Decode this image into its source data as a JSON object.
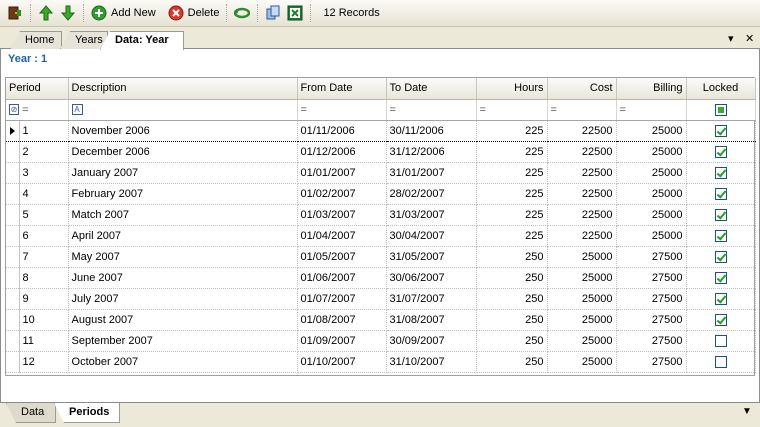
{
  "toolbar": {
    "add_new_label": "Add New",
    "delete_label": "Delete",
    "record_count": "12 Records"
  },
  "tabs": [
    {
      "label": "Home"
    },
    {
      "label": "Years"
    },
    {
      "label": "Data: Year"
    }
  ],
  "window_controls": {
    "menu": "▾",
    "close": "✕"
  },
  "caption": "Year : 1",
  "grid": {
    "columns": [
      "Period",
      "Description",
      "From Date",
      "To Date",
      "Hours",
      "Cost",
      "Billing",
      "Locked"
    ],
    "filter_op": "=",
    "rows": [
      {
        "period": "1",
        "description": "November 2006",
        "from": "01/11/2006",
        "to": "30/11/2006",
        "hours": "225",
        "cost": "22500",
        "billing": "25000",
        "locked": true
      },
      {
        "period": "2",
        "description": "December 2006",
        "from": "01/12/2006",
        "to": "31/12/2006",
        "hours": "225",
        "cost": "22500",
        "billing": "25000",
        "locked": true
      },
      {
        "period": "3",
        "description": "January 2007",
        "from": "01/01/2007",
        "to": "31/01/2007",
        "hours": "225",
        "cost": "22500",
        "billing": "25000",
        "locked": true
      },
      {
        "period": "4",
        "description": "February 2007",
        "from": "01/02/2007",
        "to": "28/02/2007",
        "hours": "225",
        "cost": "22500",
        "billing": "25000",
        "locked": true
      },
      {
        "period": "5",
        "description": "Match 2007",
        "from": "01/03/2007",
        "to": "31/03/2007",
        "hours": "225",
        "cost": "22500",
        "billing": "25000",
        "locked": true
      },
      {
        "period": "6",
        "description": "April 2007",
        "from": "01/04/2007",
        "to": "30/04/2007",
        "hours": "225",
        "cost": "22500",
        "billing": "25000",
        "locked": true
      },
      {
        "period": "7",
        "description": "May 2007",
        "from": "01/05/2007",
        "to": "31/05/2007",
        "hours": "250",
        "cost": "25000",
        "billing": "27500",
        "locked": true
      },
      {
        "period": "8",
        "description": "June 2007",
        "from": "01/06/2007",
        "to": "30/06/2007",
        "hours": "250",
        "cost": "25000",
        "billing": "27500",
        "locked": true
      },
      {
        "period": "9",
        "description": "July 2007",
        "from": "01/07/2007",
        "to": "31/07/2007",
        "hours": "250",
        "cost": "25000",
        "billing": "27500",
        "locked": true
      },
      {
        "period": "10",
        "description": "August 2007",
        "from": "01/08/2007",
        "to": "31/08/2007",
        "hours": "250",
        "cost": "25000",
        "billing": "27500",
        "locked": true
      },
      {
        "period": "11",
        "description": "September 2007",
        "from": "01/09/2007",
        "to": "30/09/2007",
        "hours": "250",
        "cost": "25000",
        "billing": "27500",
        "locked": false
      },
      {
        "period": "12",
        "description": "October 2007",
        "from": "01/10/2007",
        "to": "31/10/2007",
        "hours": "250",
        "cost": "25000",
        "billing": "27500",
        "locked": false
      }
    ]
  },
  "bottom_tabs": [
    {
      "label": "Data"
    },
    {
      "label": "Periods"
    }
  ],
  "colors": {
    "caption": "#1f5fa8",
    "check": "#21a121"
  }
}
